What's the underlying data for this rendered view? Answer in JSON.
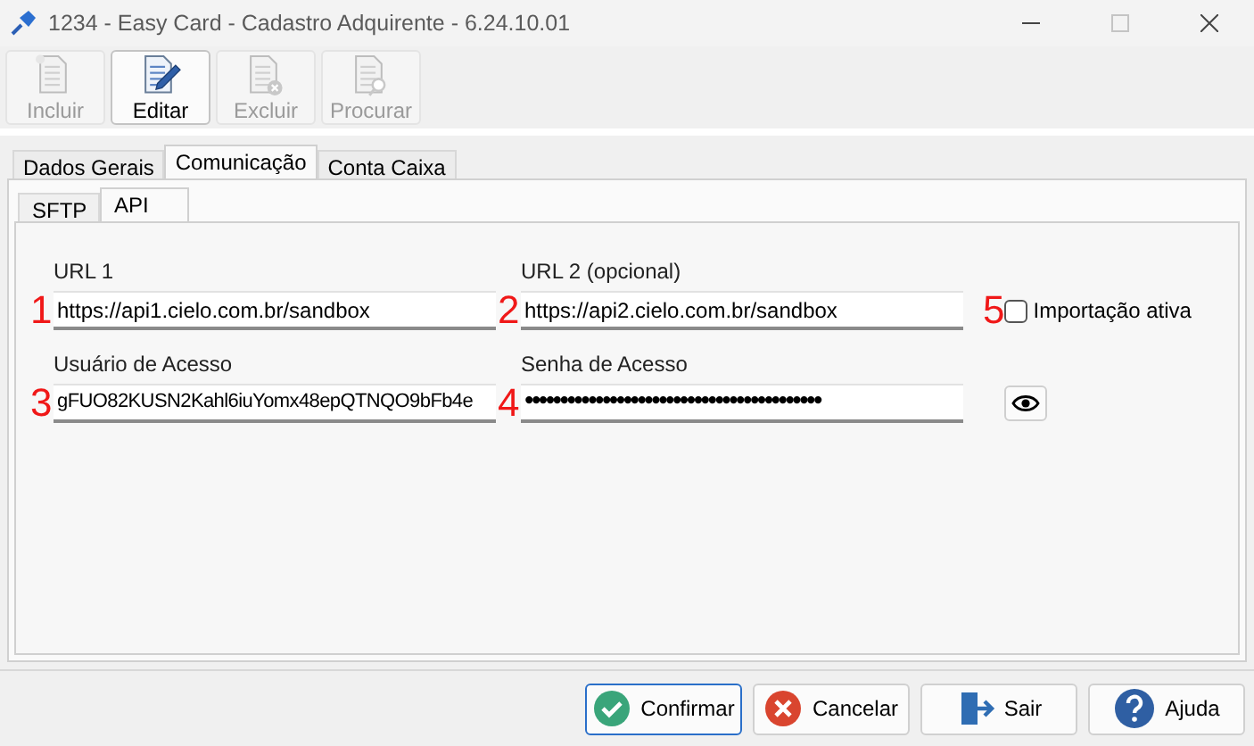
{
  "window": {
    "title": "1234 - Easy Card - Cadastro Adquirente - 6.24.10.01"
  },
  "toolbar": [
    {
      "label": "Incluir",
      "kind": "new",
      "disabled": true,
      "selected": false
    },
    {
      "label": "Editar",
      "kind": "edit",
      "disabled": false,
      "selected": true
    },
    {
      "label": "Excluir",
      "kind": "delete",
      "disabled": true,
      "selected": false
    },
    {
      "label": "Procurar",
      "kind": "search",
      "disabled": true,
      "selected": false
    }
  ],
  "tabs": [
    {
      "label": "Dados Gerais",
      "selected": false
    },
    {
      "label": "Comunicação",
      "selected": true
    },
    {
      "label": "Conta Caixa",
      "selected": false
    }
  ],
  "subtabs": [
    {
      "label": "SFTP",
      "selected": false
    },
    {
      "label": "API",
      "selected": true
    }
  ],
  "fields": [
    {
      "marker": "1",
      "label": "URL 1",
      "value": "https://api1.cielo.com.br/sandbox",
      "kind": "text"
    },
    {
      "marker": "2",
      "label": "URL 2 (opcional)",
      "value": "https://api2.cielo.com.br/sandbox",
      "kind": "text"
    },
    {
      "marker": "3",
      "label": "Usuário de Acesso",
      "value": "gFUO82KUSN2Kahl6iuYomx48epQTNQO9bFb4e",
      "kind": "text"
    },
    {
      "marker": "4",
      "label": "Senha de Acesso",
      "value": "••••••••••••••••••••••••••••••••••••••••••",
      "kind": "password"
    }
  ],
  "import_option": {
    "marker": "5",
    "label": "Importação ativa",
    "checked": false
  },
  "buttons": [
    {
      "label": "Confirmar",
      "kind": "confirm",
      "focused": true
    },
    {
      "label": "Cancelar",
      "kind": "cancel",
      "focused": false
    },
    {
      "label": "Sair",
      "kind": "exit",
      "focused": false
    },
    {
      "label": "Ajuda",
      "kind": "help",
      "focused": false
    }
  ]
}
